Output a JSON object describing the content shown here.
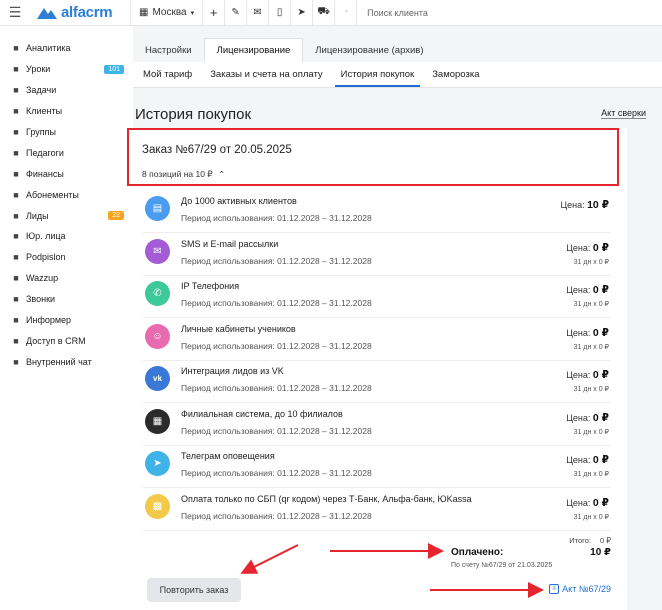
{
  "topbar": {
    "logo_text": "alfacrm",
    "city": "Москва",
    "search_placeholder": "Поиск клиента"
  },
  "sidebar": {
    "items": [
      {
        "label": "Аналитика",
        "icon": "chart-icon"
      },
      {
        "label": "Уроки",
        "icon": "calendar-icon",
        "badge": "101",
        "badge_color": "#3fb3e8"
      },
      {
        "label": "Задачи",
        "icon": "task-icon"
      },
      {
        "label": "Клиенты",
        "icon": "user-icon"
      },
      {
        "label": "Группы",
        "icon": "users-icon"
      },
      {
        "label": "Педагоги",
        "icon": "graduation-cap-icon"
      },
      {
        "label": "Финансы",
        "icon": "money-icon"
      },
      {
        "label": "Абонементы",
        "icon": "ticket-icon"
      },
      {
        "label": "Лиды",
        "icon": "lead-icon",
        "badge": "22",
        "badge_color": "#f5a623"
      },
      {
        "label": "Юр. лица",
        "icon": "building-icon"
      },
      {
        "label": "Podpislon",
        "icon": "doc-icon"
      },
      {
        "label": "Wazzup",
        "icon": "chat-icon"
      },
      {
        "label": "Звонки",
        "icon": "phone-icon"
      },
      {
        "label": "Информер",
        "icon": "informer-icon"
      },
      {
        "label": "Доступ в CRM",
        "icon": "lock-icon"
      },
      {
        "label": "Внутренний чат",
        "icon": "message-icon"
      }
    ]
  },
  "tabs": [
    "Настройки",
    "Лицензирование",
    "Лицензирование (архив)"
  ],
  "subtabs": [
    "Мой тариф",
    "Заказы и счета на оплату",
    "История покупок",
    "Заморозка"
  ],
  "page_title": "История покупок",
  "act_link": "Акт сверки",
  "order": {
    "title": "Заказ №67/29 от 20.05.2025",
    "subtitle": "8 позиций на 10 ₽"
  },
  "items": [
    {
      "name": "До 1000 активных клиентов",
      "period": "Период использования: 01.12.2028 – 31.12.2028",
      "price_label": "Цена:",
      "price": "10 ₽",
      "price_sub": "",
      "color": "#4a9cf0",
      "icon": "clipboard-icon",
      "glyph": "▤"
    },
    {
      "name": "SMS и E-mail рассылки",
      "period": "Период использования: 01.12.2028 – 31.12.2028",
      "price_label": "Цена:",
      "price": "0 ₽",
      "price_sub": "31 дн x 0 ₽",
      "color": "#a45cd6",
      "icon": "envelope-icon",
      "glyph": "✉"
    },
    {
      "name": "IP Телефония",
      "period": "Период использования: 01.12.2028 – 31.12.2028",
      "price_label": "Цена:",
      "price": "0 ₽",
      "price_sub": "31 дн x 0 ₽",
      "color": "#3ec99a",
      "icon": "phone-icon",
      "glyph": "✆"
    },
    {
      "name": "Личные кабинеты учеников",
      "period": "Период использования: 01.12.2028 – 31.12.2028",
      "price_label": "Цена:",
      "price": "0 ₽",
      "price_sub": "31 дн x 0 ₽",
      "color": "#e86bb0",
      "icon": "student-icon",
      "glyph": "☺"
    },
    {
      "name": "Интеграция лидов из VK",
      "period": "Период использования: 01.12.2028 – 31.12.2028",
      "price_label": "Цена:",
      "price": "0 ₽",
      "price_sub": "31 дн x 0 ₽",
      "color": "#3a78d8",
      "icon": "vk-icon",
      "glyph": "vk"
    },
    {
      "name": "Филиальная система, до 10 филиалов",
      "period": "Период использования: 01.12.2028 – 31.12.2028",
      "price_label": "Цена:",
      "price": "0 ₽",
      "price_sub": "31 дн x 0 ₽",
      "color": "#2b2b2b",
      "icon": "branches-icon",
      "glyph": "▦"
    },
    {
      "name": "Телеграм оповещения",
      "period": "Период использования: 01.12.2028 – 31.12.2028",
      "price_label": "Цена:",
      "price": "0 ₽",
      "price_sub": "31 дн x 0 ₽",
      "color": "#3fb3e8",
      "icon": "telegram-icon",
      "glyph": "➤"
    },
    {
      "name": "Оплата только по СБП (qr кодом) через Т-Банк, Альфа-банк, ЮKassa",
      "period": "Период использования: 01.12.2028 – 31.12.2028",
      "price_label": "Цена:",
      "price": "0 ₽",
      "price_sub": "31 дн x 0 ₽",
      "color": "#f3c94a",
      "icon": "qr-icon",
      "glyph": "▩"
    }
  ],
  "totals": {
    "total_label": "Итого:",
    "total_value": "0 ₽",
    "paid_label": "Оплачено:",
    "paid_value": "10 ₽",
    "invoice_note": "По счету №67/29 от 21.03.2025"
  },
  "repeat_button": "Повторить заказ",
  "akt_link": "Акт №67/29",
  "colors": {
    "accent": "#1e6fd9",
    "highlight": "#e5262e"
  }
}
